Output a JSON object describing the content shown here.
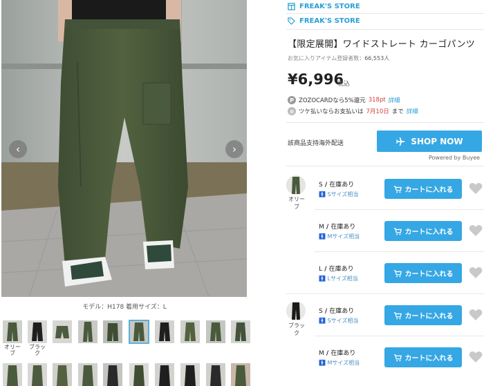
{
  "gallery": {
    "caption": "モデル：H178 着用サイズ：L",
    "thumb_labels": [
      "オリーブ",
      "ブラック"
    ],
    "prev_icon": "chevron-left-icon",
    "next_icon": "chevron-right-icon"
  },
  "product": {
    "brand_primary": "FREAK'S STORE",
    "brand_secondary": "FREAK'S STORE",
    "title": "【限定展開】ワイドストレート カーゴパンツ",
    "fav_label": "お気に入りアイテム登録者数：",
    "fav_count": "66,553人",
    "price": "¥6,996",
    "tax_label": "税込"
  },
  "promos": {
    "zozo_text": "ZOZOCARDなら5%還元",
    "zozo_points": "318pt",
    "zozo_link": "詳細",
    "tsuke_text_pre": "ツケ払いならお支払いは",
    "tsuke_date": "7月10日",
    "tsuke_text_post": "まで",
    "tsuke_link": "詳細"
  },
  "overseas": {
    "label": "該商品支持海外配送",
    "shop_now": "SHOP NOW",
    "powered_by": "Powered by Buyee"
  },
  "sizes": [
    {
      "color": "オリーブ",
      "size": "S",
      "stock": "在庫あり",
      "fit": "Sサイズ相当",
      "cart": "カートに入れる"
    },
    {
      "color": "",
      "size": "M",
      "stock": "在庫あり",
      "fit": "Mサイズ相当",
      "cart": "カートに入れる"
    },
    {
      "color": "",
      "size": "L",
      "stock": "在庫あり",
      "fit": "Lサイズ相当",
      "cart": "カートに入れる"
    },
    {
      "color": "ブラック",
      "size": "S",
      "stock": "在庫あり",
      "fit": "Sサイズ相当",
      "cart": "カートに入れる"
    },
    {
      "color": "",
      "size": "M",
      "stock": "在庫あり",
      "fit": "Mサイズ相当",
      "cart": "カートに入れる"
    }
  ],
  "colors": {
    "accent": "#35a7e4",
    "brand_link": "#2a9fd6",
    "highlight_red": "#d83a3a",
    "olive": "#4a5a3c"
  }
}
